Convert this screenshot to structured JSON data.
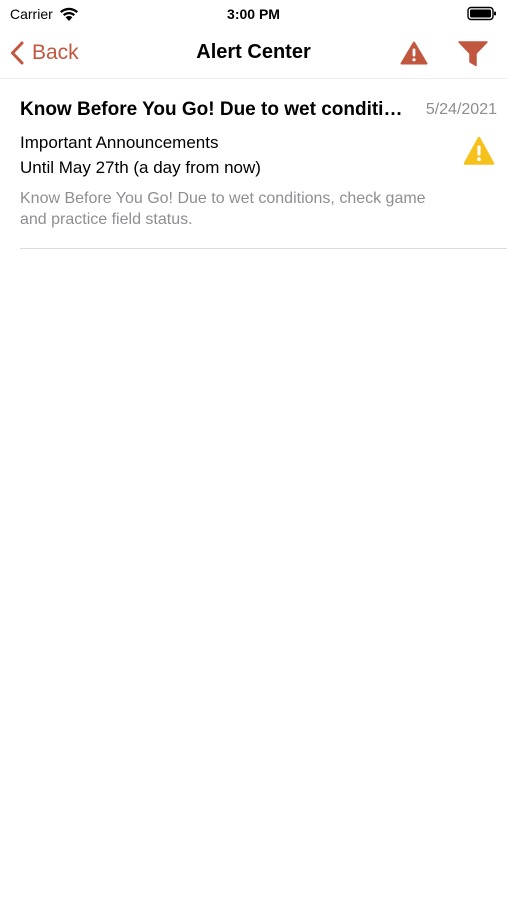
{
  "status_bar": {
    "carrier": "Carrier",
    "time": "3:00 PM",
    "wifi_icon": "wifi-icon",
    "battery_icon": "battery-full-icon"
  },
  "nav": {
    "back_label": "Back",
    "title": "Alert Center",
    "alert_icon": "warning-triangle-icon",
    "filter_icon": "filter-funnel-icon",
    "accent_color": "#c1573f"
  },
  "alerts": [
    {
      "title": "Know Before You Go! Due to wet conditions, check game and practice field status.",
      "date": "5/24/2021",
      "category": "Important Announcements",
      "until": "Until May 27th (a day from now)",
      "body": "Know Before You Go! Due to wet conditions, check game and practice field status.",
      "severity_icon": "warning-triangle-icon",
      "severity_color": "#f7c11c"
    }
  ]
}
